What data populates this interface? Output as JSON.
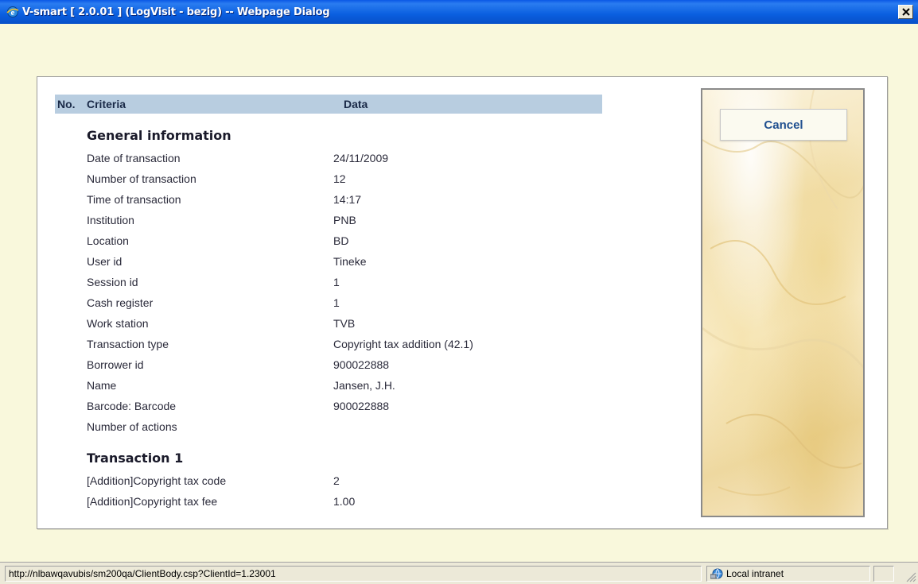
{
  "window": {
    "title": "V-smart [ 2.0.01 ] (LogVisit - bezig) -- Webpage Dialog",
    "close_symbol": "×"
  },
  "table": {
    "headers": {
      "no": "No.",
      "criteria": "Criteria",
      "data": "Data"
    }
  },
  "sections": [
    {
      "title": "General information",
      "rows": [
        {
          "criteria": "Date of transaction",
          "data": "24/11/2009"
        },
        {
          "criteria": "Number of transaction",
          "data": "12"
        },
        {
          "criteria": "Time of transaction",
          "data": "14:17"
        },
        {
          "criteria": "Institution",
          "data": "PNB"
        },
        {
          "criteria": "Location",
          "data": "BD"
        },
        {
          "criteria": "User id",
          "data": "Tineke"
        },
        {
          "criteria": "Session id",
          "data": "1"
        },
        {
          "criteria": "Cash register",
          "data": "1"
        },
        {
          "criteria": "Work station",
          "data": "TVB"
        },
        {
          "criteria": "Transaction type",
          "data": "Copyright tax addition (42.1)"
        },
        {
          "criteria": "Borrower id",
          "data": "900022888"
        },
        {
          "criteria": "Name",
          "data": "Jansen, J.H."
        },
        {
          "criteria": "Barcode: Barcode",
          "data": "900022888"
        },
        {
          "criteria": "Number of actions",
          "data": ""
        }
      ]
    },
    {
      "title": "Transaction 1",
      "rows": [
        {
          "criteria": "[Addition]Copyright tax code",
          "data": "2"
        },
        {
          "criteria": "[Addition]Copyright tax fee",
          "data": "1.00"
        }
      ]
    }
  ],
  "actions": {
    "cancel_label": "Cancel"
  },
  "statusbar": {
    "url": "http://nlbawqavubis/sm200qa/ClientBody.csp?ClientId=1.23001",
    "zone": "Local intranet"
  },
  "icons": {
    "window_icon": "ie-icon",
    "zone_icon": "intranet-icon"
  }
}
